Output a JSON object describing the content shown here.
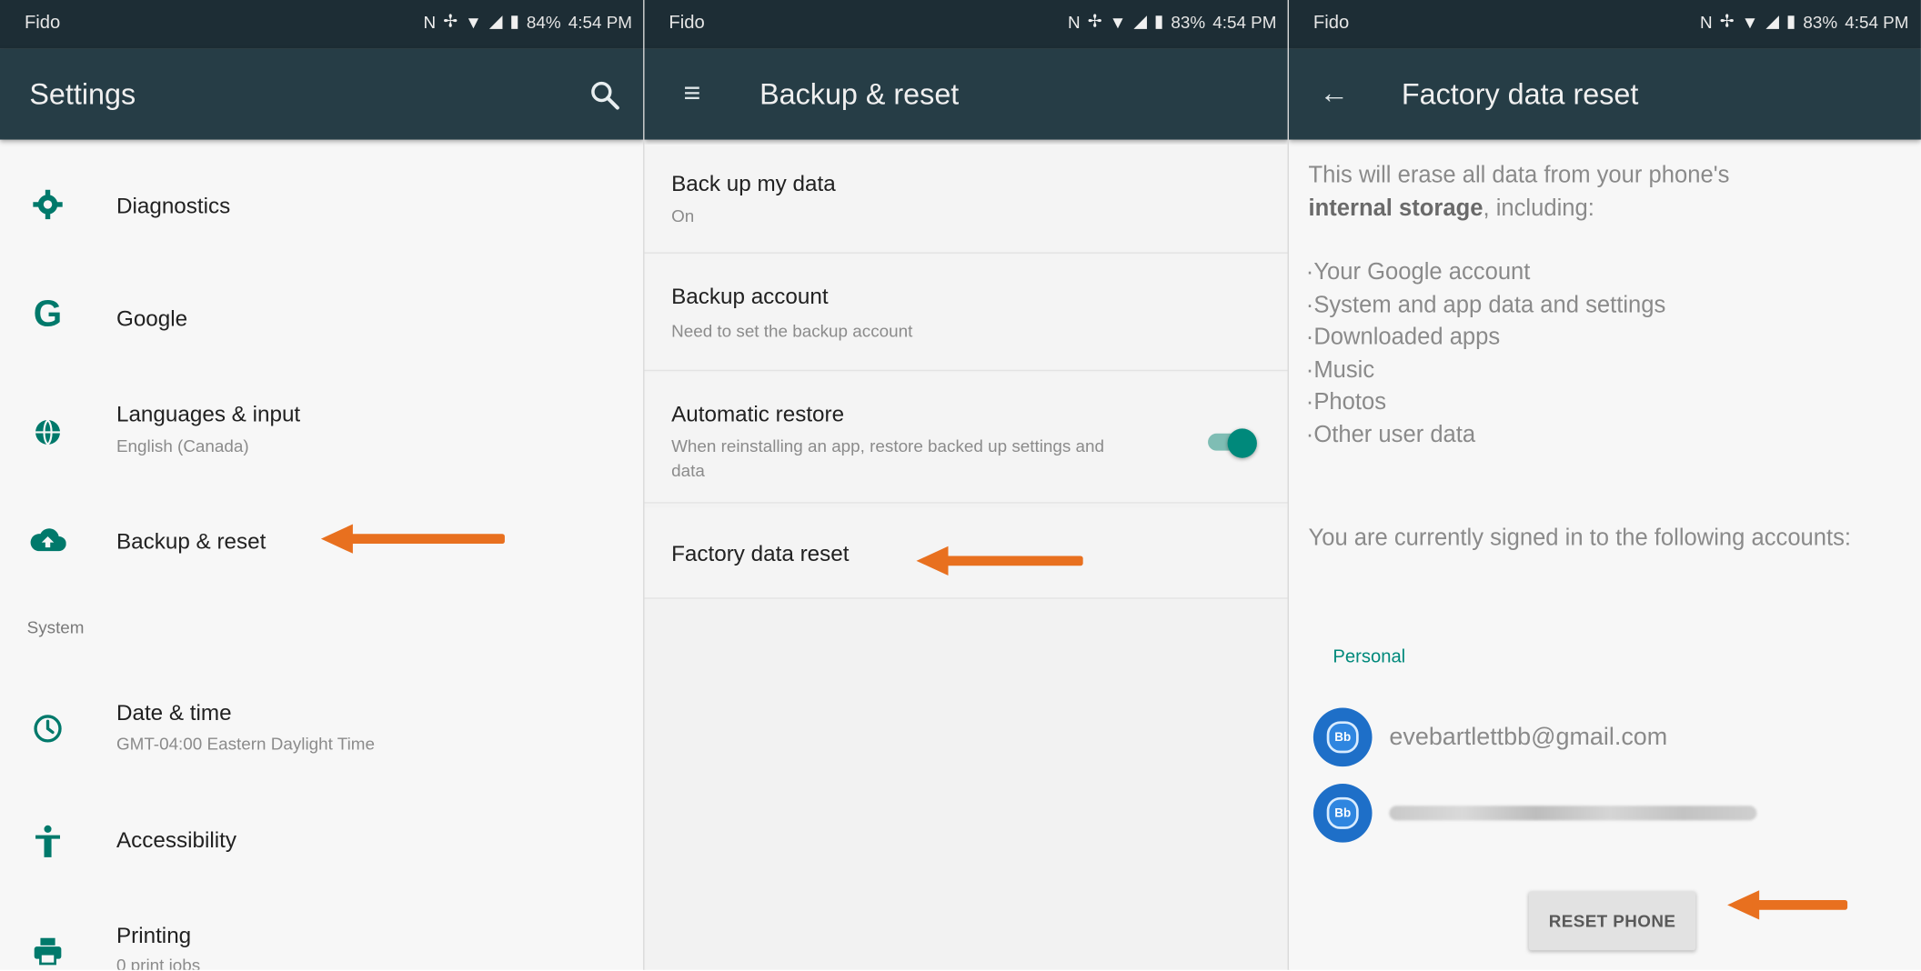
{
  "status_bar": {
    "carrier": "Fido",
    "screens": [
      {
        "battery": "84%",
        "time": "4:54 PM"
      },
      {
        "battery": "83%",
        "time": "4:54 PM"
      },
      {
        "battery": "83%",
        "time": "4:54 PM"
      }
    ]
  },
  "settings": {
    "title": "Settings",
    "items": [
      {
        "label": "Diagnostics",
        "icon": "gear-icon"
      },
      {
        "label": "Google",
        "icon": "google-icon"
      },
      {
        "label": "Languages & input",
        "sub": "English (Canada)",
        "icon": "globe-icon"
      },
      {
        "label": "Backup & reset",
        "icon": "cloud-upload-icon"
      }
    ],
    "section": "System",
    "system_items": [
      {
        "label": "Date & time",
        "sub": "GMT-04:00 Eastern Daylight Time",
        "icon": "clock-icon"
      },
      {
        "label": "Accessibility",
        "icon": "accessibility-icon"
      },
      {
        "label": "Printing",
        "sub": "0 print jobs",
        "icon": "printer-icon"
      }
    ]
  },
  "backup_reset": {
    "title": "Backup & reset",
    "rows": [
      {
        "label": "Back up my data",
        "sub": "On"
      },
      {
        "label": "Backup account",
        "sub": "Need to set the backup account"
      },
      {
        "label": "Automatic restore",
        "sub": "When reinstalling an app, restore backed up settings and data"
      },
      {
        "label": "Factory data reset"
      }
    ],
    "automatic_restore_enabled": true
  },
  "factory_reset": {
    "title": "Factory data reset",
    "intro_1": "This will erase all data from your phone's",
    "intro_bold": "internal storage",
    "intro_2": ", including:",
    "bullets": [
      "·Your Google account",
      "·System and app data and settings",
      "·Downloaded apps",
      "·Music",
      "·Photos",
      "·Other user data"
    ],
    "signed_in": "You are currently signed in to the following accounts:",
    "personal_label": "Personal",
    "account_email": "evebartlettbb@gmail.com",
    "avatar_text": "Bb",
    "reset_button": "RESET PHONE"
  },
  "colors": {
    "status_bar": "#1d2d35",
    "app_bar": "#263d46",
    "accent": "#00796b",
    "arrow": "#e8701f"
  }
}
